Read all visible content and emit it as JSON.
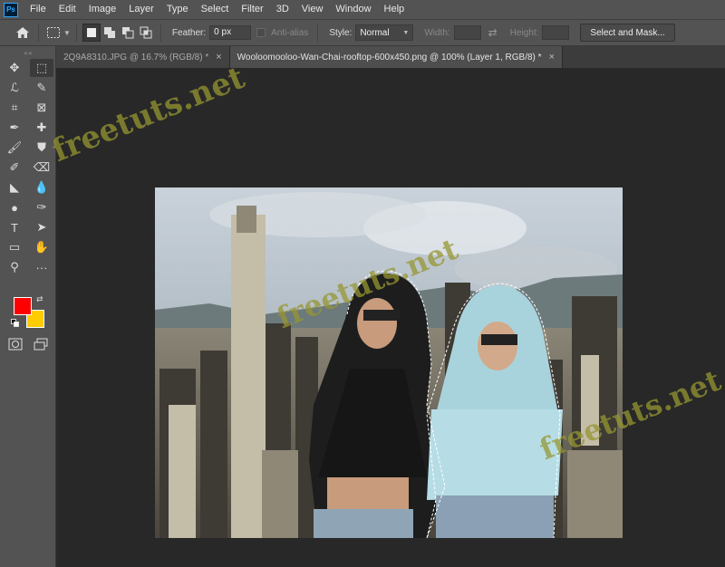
{
  "menu": {
    "logo": "Ps",
    "items": [
      "File",
      "Edit",
      "Image",
      "Layer",
      "Type",
      "Select",
      "Filter",
      "3D",
      "View",
      "Window",
      "Help"
    ]
  },
  "options": {
    "feather_label": "Feather:",
    "feather_value": "0 px",
    "antialias_label": "Anti-alias",
    "style_label": "Style:",
    "style_value": "Normal",
    "width_label": "Width:",
    "height_label": "Height:",
    "select_mask_label": "Select and Mask..."
  },
  "tabs": [
    {
      "label": "2Q9A8310.JPG @ 16.7% (RGB/8) *",
      "close": "×"
    },
    {
      "label": "Wooloomooloo-Wan-Chai-rooftop-600x450.png @ 100% (Layer 1, RGB/8) *",
      "close": "×"
    }
  ],
  "toolbar": {
    "grip": "◂◂",
    "tools": [
      "move-tool",
      "rectangular-marquee-tool",
      "lasso-tool",
      "quick-selection-tool",
      "crop-tool",
      "frame-tool",
      "eyedropper-tool",
      "healing-brush-tool",
      "brush-tool",
      "clone-stamp-tool",
      "history-brush-tool",
      "eraser-tool",
      "paint-bucket-tool",
      "blur-tool",
      "dodge-tool",
      "pen-tool",
      "type-tool",
      "path-selection-tool",
      "rectangle-tool",
      "hand-tool",
      "zoom-tool",
      "more-tools"
    ],
    "glyphs": [
      "✥",
      "⬚",
      "ℒ",
      "✎",
      "⌗",
      "⊠",
      "✒",
      "✚",
      "🖌",
      "⛊",
      "✐",
      "⌫",
      "◣",
      "💧",
      "●",
      "✑",
      "T",
      "➤",
      "▭",
      "✋",
      "⚲",
      "···"
    ]
  },
  "colors": {
    "foreground": "#ff0000",
    "background": "#ffcc00",
    "swap_glyph": "⇄"
  },
  "watermarks": [
    "freetuts.net",
    "freetuts.net",
    "freetuts.net"
  ]
}
